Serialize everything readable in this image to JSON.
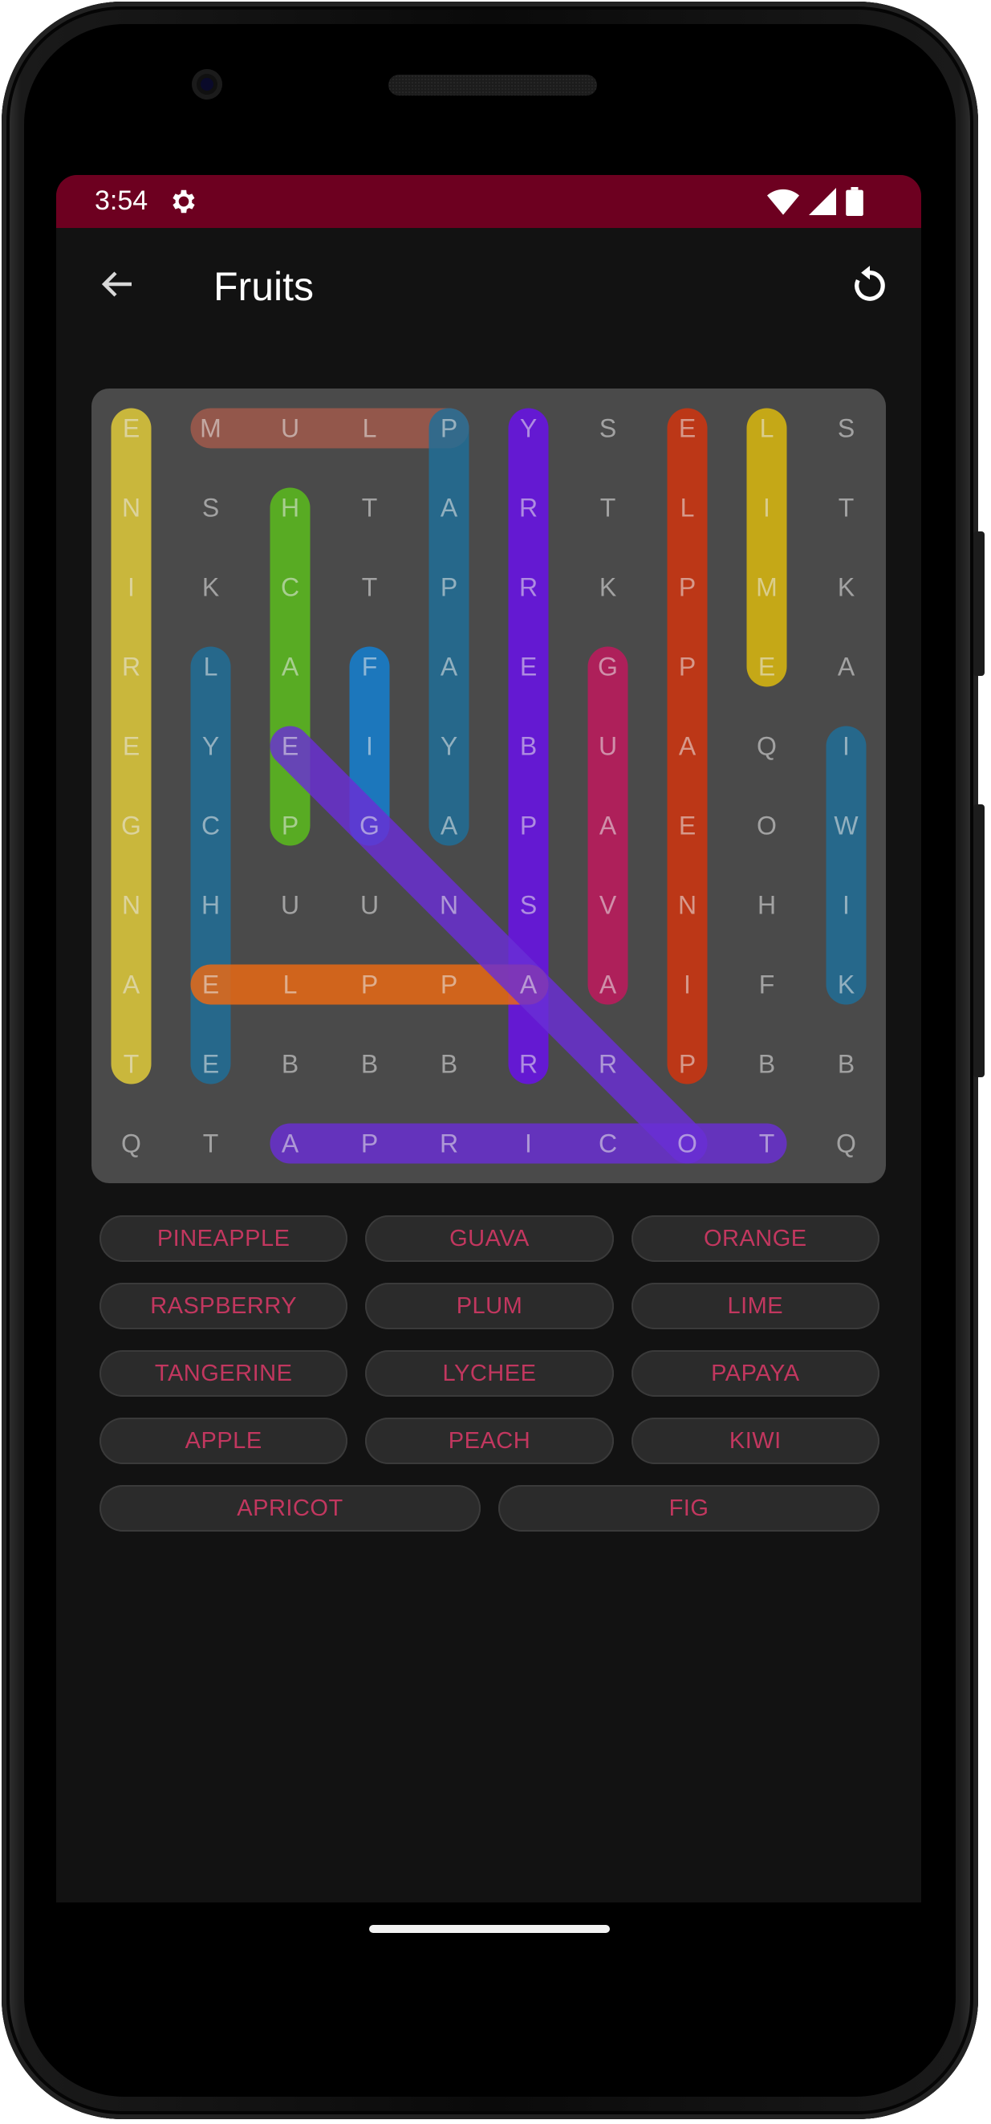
{
  "status": {
    "time": "3:54",
    "settings_icon": "gear-icon",
    "wifi_icon": "wifi-icon",
    "signal_icon": "signal-icon",
    "battery_icon": "battery-icon"
  },
  "appbar": {
    "title": "Fruits",
    "back_icon": "arrow-left-icon",
    "refresh_icon": "refresh-icon"
  },
  "colors": {
    "status_bar": "#6d0020",
    "background": "#121212",
    "board": "#4a4a4a",
    "word_text": "#c2375f",
    "chip_bg": "#2b2b2b"
  },
  "grid": [
    [
      "E",
      "M",
      "U",
      "L",
      "P",
      "Y",
      "S",
      "E",
      "L",
      "S"
    ],
    [
      "N",
      "S",
      "H",
      "T",
      "A",
      "R",
      "T",
      "L",
      "I",
      "T"
    ],
    [
      "I",
      "K",
      "C",
      "T",
      "P",
      "R",
      "K",
      "P",
      "M",
      "K"
    ],
    [
      "R",
      "L",
      "A",
      "F",
      "A",
      "E",
      "G",
      "P",
      "E",
      "A"
    ],
    [
      "E",
      "Y",
      "E",
      "I",
      "Y",
      "B",
      "U",
      "A",
      "Q",
      "I"
    ],
    [
      "G",
      "C",
      "P",
      "G",
      "A",
      "P",
      "A",
      "E",
      "O",
      "W"
    ],
    [
      "N",
      "H",
      "U",
      "U",
      "N",
      "S",
      "V",
      "N",
      "H",
      "I"
    ],
    [
      "A",
      "E",
      "L",
      "P",
      "P",
      "A",
      "A",
      "I",
      "F",
      "K"
    ],
    [
      "T",
      "E",
      "B",
      "B",
      "B",
      "R",
      "R",
      "P",
      "B",
      "B"
    ],
    [
      "Q",
      "T",
      "A",
      "P",
      "R",
      "I",
      "C",
      "O",
      "T",
      "Q"
    ]
  ],
  "found_words": [
    {
      "word": "TANGERINE",
      "from": [
        8,
        0
      ],
      "to": [
        0,
        0
      ],
      "color": "#e6cf3a"
    },
    {
      "word": "PLUM",
      "from": [
        0,
        4
      ],
      "to": [
        0,
        1
      ],
      "color": "#a35a4c"
    },
    {
      "word": "PAPAYA",
      "from": [
        0,
        4
      ],
      "to": [
        5,
        4
      ],
      "color": "#1f6f9a"
    },
    {
      "word": "RASPBERRY",
      "from": [
        8,
        5
      ],
      "to": [
        0,
        5
      ],
      "color": "#6a0ff0"
    },
    {
      "word": "PINEAPPLE",
      "from": [
        8,
        7
      ],
      "to": [
        0,
        7
      ],
      "color": "#d6340d"
    },
    {
      "word": "LIME",
      "from": [
        0,
        8
      ],
      "to": [
        3,
        8
      ],
      "color": "#e1bd0c"
    },
    {
      "word": "PEACH",
      "from": [
        5,
        2
      ],
      "to": [
        1,
        2
      ],
      "color": "#5cc11b"
    },
    {
      "word": "LYCHEE",
      "from": [
        3,
        1
      ],
      "to": [
        8,
        1
      ],
      "color": "#1f6f9a"
    },
    {
      "word": "FIG",
      "from": [
        3,
        3
      ],
      "to": [
        5,
        3
      ],
      "color": "#1281d6"
    },
    {
      "word": "GUAVA",
      "from": [
        3,
        6
      ],
      "to": [
        7,
        6
      ],
      "color": "#c4185e"
    },
    {
      "word": "KIWI",
      "from": [
        7,
        9
      ],
      "to": [
        4,
        9
      ],
      "color": "#1f6f9a"
    },
    {
      "word": "APPLE",
      "from": [
        7,
        5
      ],
      "to": [
        7,
        1
      ],
      "color": "#ee6a12"
    },
    {
      "word": "APRICOT",
      "from": [
        9,
        2
      ],
      "to": [
        9,
        8
      ],
      "color": "#6a2fd6"
    },
    {
      "word": "ORANGE",
      "from": [
        9,
        7
      ],
      "to": [
        4,
        2
      ],
      "color": "#6a2fd6"
    }
  ],
  "word_list": [
    [
      "PINEAPPLE",
      "GUAVA",
      "ORANGE"
    ],
    [
      "RASPBERRY",
      "PLUM",
      "LIME"
    ],
    [
      "TANGERINE",
      "LYCHEE",
      "PAPAYA"
    ],
    [
      "APPLE",
      "PEACH",
      "KIWI"
    ],
    [
      "APRICOT",
      "FIG"
    ]
  ]
}
